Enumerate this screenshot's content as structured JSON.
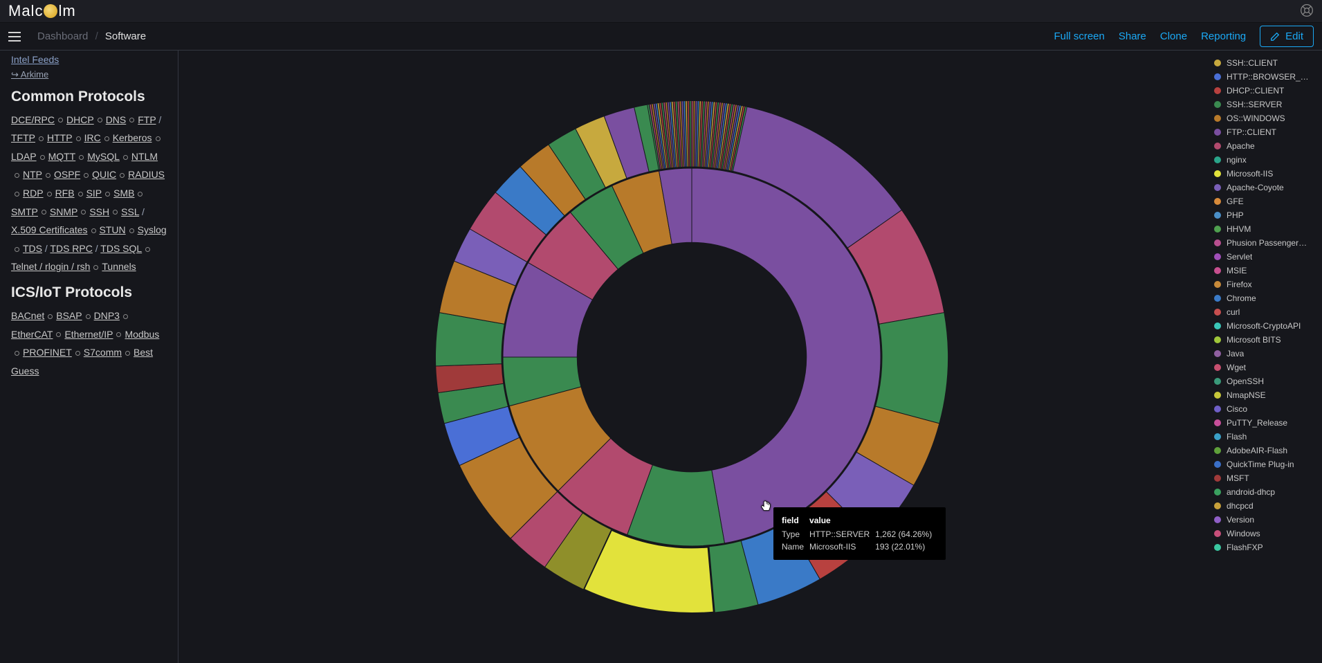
{
  "header": {
    "logo_text_1": "Malc",
    "logo_text_2": "lm"
  },
  "breadcrumb": {
    "root": "Dashboard",
    "current": "Software"
  },
  "toolbar": {
    "fullscreen": "Full screen",
    "share": "Share",
    "clone": "Clone",
    "reporting": "Reporting",
    "edit": "Edit"
  },
  "sidebar": {
    "top_link": "Intel Feeds",
    "arkime_link": "↪ Arkime",
    "common_heading": "Common Protocols",
    "common_items": [
      "DCE/RPC",
      "DHCP",
      "DNS",
      "FTP",
      "/",
      "TFTP",
      "HTTP",
      "IRC",
      "Kerberos",
      "LDAP",
      "MQTT",
      "MySQL",
      "NTLM",
      "NTP",
      "OSPF",
      "QUIC",
      "RADIUS",
      "RDP",
      "RFB",
      "SIP",
      "SMB",
      "SMTP",
      "SNMP",
      "SSH",
      "SSL",
      "/",
      "X.509 Certificates",
      "STUN",
      "Syslog",
      "TDS",
      "/",
      "TDS RPC",
      "/",
      "TDS SQL",
      "Telnet / rlogin / rsh",
      "Tunnels"
    ],
    "ics_heading": "ICS/IoT Protocols",
    "ics_items": [
      "BACnet",
      "BSAP",
      "DNP3",
      "EtherCAT",
      "Ethernet/IP",
      "Modbus",
      "PROFINET",
      "S7comm",
      "Best Guess"
    ]
  },
  "legend_items": [
    {
      "label": "SSH::CLIENT",
      "color": "#c7a93e"
    },
    {
      "label": "HTTP::BROWSER_…",
      "color": "#4a6fd6"
    },
    {
      "label": "DHCP::CLIENT",
      "color": "#b8413f"
    },
    {
      "label": "SSH::SERVER",
      "color": "#3a8a50"
    },
    {
      "label": "OS::WINDOWS",
      "color": "#b87a2a"
    },
    {
      "label": "FTP::CLIENT",
      "color": "#7a4fa0"
    },
    {
      "label": "Apache",
      "color": "#b24a6e"
    },
    {
      "label": "nginx",
      "color": "#2aa58a"
    },
    {
      "label": "Microsoft-IIS",
      "color": "#e2e23b"
    },
    {
      "label": "Apache-Coyote",
      "color": "#7a5fb8"
    },
    {
      "label": "GFE",
      "color": "#d78a3a"
    },
    {
      "label": "PHP",
      "color": "#4a8fc7"
    },
    {
      "label": "HHVM",
      "color": "#4fa04f"
    },
    {
      "label": "Phusion Passenger…",
      "color": "#b84f8f"
    },
    {
      "label": "Servlet",
      "color": "#a04fb8"
    },
    {
      "label": "MSIE",
      "color": "#c74f8f"
    },
    {
      "label": "Firefox",
      "color": "#c78a3a"
    },
    {
      "label": "Chrome",
      "color": "#3a7ac7"
    },
    {
      "label": "curl",
      "color": "#c74f4f"
    },
    {
      "label": "Microsoft-CryptoAPI",
      "color": "#3ac7b8"
    },
    {
      "label": "Microsoft BITS",
      "color": "#a0c73a"
    },
    {
      "label": "Java",
      "color": "#8f5fa0"
    },
    {
      "label": "Wget",
      "color": "#c74f6f"
    },
    {
      "label": "OpenSSH",
      "color": "#3a9a7a"
    },
    {
      "label": "NmapNSE",
      "color": "#c7c73a"
    },
    {
      "label": "Cisco",
      "color": "#6f5fc7"
    },
    {
      "label": "PuTTY_Release",
      "color": "#c74f9a"
    },
    {
      "label": "Flash",
      "color": "#3aa0c7"
    },
    {
      "label": "AdobeAIR-Flash",
      "color": "#5fa03a"
    },
    {
      "label": "QuickTime Plug-in",
      "color": "#3a6fc7"
    },
    {
      "label": "MSFT",
      "color": "#a03a3a"
    },
    {
      "label": "android-dhcp",
      "color": "#3aa05f"
    },
    {
      "label": "dhcpcd",
      "color": "#c7a03a"
    },
    {
      "label": "Version",
      "color": "#8f5fc7"
    },
    {
      "label": "Windows",
      "color": "#c74f7a"
    },
    {
      "label": "FlashFXP",
      "color": "#3ac7a0"
    }
  ],
  "tooltip": {
    "field_label": "field",
    "value_label": "value",
    "rows": [
      {
        "field": "Type",
        "v1": "HTTP::SERVER",
        "v2": "1,262 (64.26%)"
      },
      {
        "field": "Name",
        "v1": "Microsoft-IIS",
        "v2": "193 (22.01%)"
      }
    ]
  },
  "chart_data": {
    "type": "sunburst",
    "title": "Software",
    "rings": [
      "Type",
      "Name"
    ],
    "inner_ring": [
      {
        "name": "HTTP::SERVER",
        "value": 1262,
        "pct": 64.26,
        "children": [
          {
            "name": "Microsoft-IIS",
            "value": 193,
            "pct": 22.01
          },
          {
            "name": "Apache",
            "value": null
          },
          {
            "name": "nginx",
            "value": null
          },
          {
            "name": "Apache-Coyote",
            "value": null
          },
          {
            "name": "GFE",
            "value": null
          },
          {
            "name": "PHP",
            "value": null
          },
          {
            "name": "HHVM",
            "value": null
          },
          {
            "name": "Phusion Passenger",
            "value": null
          },
          {
            "name": "Servlet",
            "value": null
          }
        ]
      },
      {
        "name": "SSH::CLIENT",
        "value": null
      },
      {
        "name": "HTTP::BROWSER",
        "value": null,
        "children": [
          {
            "name": "MSIE"
          },
          {
            "name": "Firefox"
          },
          {
            "name": "Chrome"
          },
          {
            "name": "curl"
          },
          {
            "name": "Microsoft-CryptoAPI"
          },
          {
            "name": "Microsoft BITS"
          },
          {
            "name": "Java"
          },
          {
            "name": "Wget"
          }
        ]
      },
      {
        "name": "DHCP::CLIENT",
        "value": null,
        "children": [
          {
            "name": "MSFT"
          },
          {
            "name": "android-dhcp"
          },
          {
            "name": "dhcpcd"
          }
        ]
      },
      {
        "name": "SSH::SERVER",
        "value": null,
        "children": [
          {
            "name": "OpenSSH"
          },
          {
            "name": "Cisco"
          }
        ]
      },
      {
        "name": "OS::WINDOWS",
        "value": null,
        "children": [
          {
            "name": "Windows"
          }
        ]
      },
      {
        "name": "FTP::CLIENT",
        "value": null,
        "children": [
          {
            "name": "FlashFXP"
          },
          {
            "name": "PuTTY_Release"
          }
        ]
      }
    ]
  }
}
